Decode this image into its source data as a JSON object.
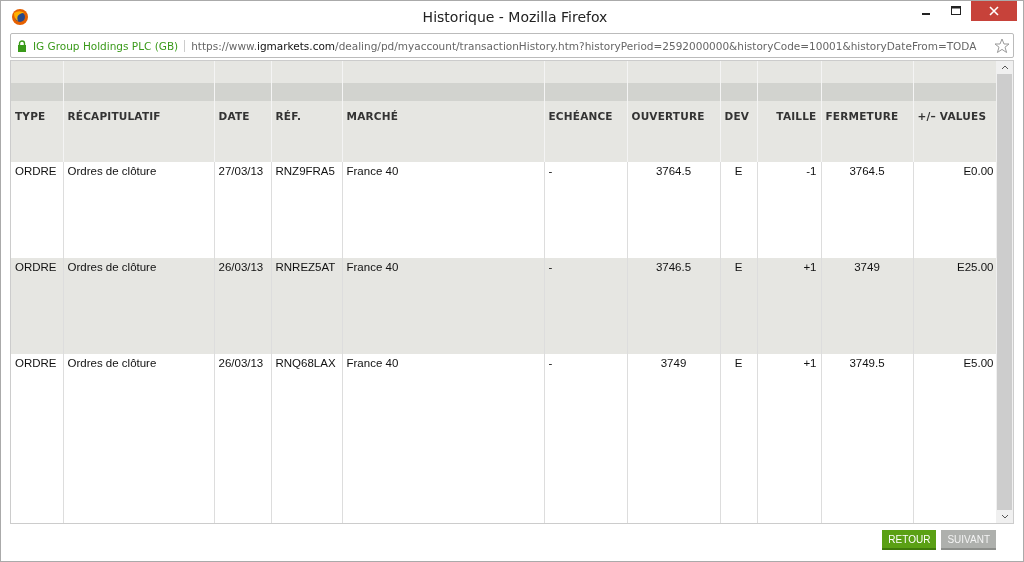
{
  "window": {
    "title": "Historique - Mozilla Firefox"
  },
  "address_bar": {
    "identity": "IG Group Holdings PLC (GB)",
    "url_prefix": "https://www.",
    "url_domain": "igmarkets.com",
    "url_rest": "/dealing/pd/myaccount/transactionHistory.htm?historyPeriod=2592000000&historyCode=10001&historyDateFrom=TODA"
  },
  "table": {
    "columns": [
      "TYPE",
      "RÉCAPITULATIF",
      "DATE",
      "RÉF.",
      "MARCHÉ",
      "ECHÉANCE",
      "OUVERTURE",
      "DEV",
      "TAILLE",
      "FERMETURE",
      "+/– VALUES"
    ],
    "rows": [
      {
        "cells": [
          "ORDRE",
          "Ordres de clôture",
          "27/03/13",
          "RNZ9FRA5",
          "France 40",
          "-",
          "3764.5",
          "E",
          "-1",
          "3764.5",
          "E0.00"
        ]
      },
      {
        "cells": [
          "ORDRE",
          "Ordres de clôture",
          "26/03/13",
          "RNREZ5AT",
          "France 40",
          "-",
          "3746.5",
          "E",
          "+1",
          "3749",
          "E25.00"
        ]
      },
      {
        "cells": [
          "ORDRE",
          "Ordres de clôture",
          "26/03/13",
          "RNQ68LAX",
          "France 40",
          "-",
          "3749",
          "E",
          "+1",
          "3749.5",
          "E5.00"
        ]
      }
    ]
  },
  "buttons": [
    {
      "label": "RETOUR",
      "disabled": false
    },
    {
      "label": "SUIVANT",
      "disabled": true
    }
  ]
}
